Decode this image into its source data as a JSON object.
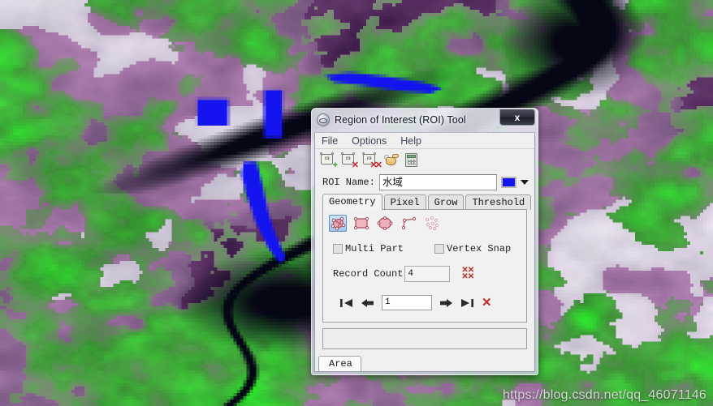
{
  "window": {
    "title": "Region of Interest (ROI) Tool",
    "title_icon": "roi-app-icon",
    "close_label": "x"
  },
  "menubar": {
    "items": [
      {
        "label": "File"
      },
      {
        "label": "Options"
      },
      {
        "label": "Help"
      }
    ]
  },
  "toolbar": {
    "items": [
      {
        "name": "new-roi-icon",
        "badge": "+",
        "glyph": "roi"
      },
      {
        "name": "delete-roi-icon",
        "badge": "x",
        "glyph": "roi"
      },
      {
        "name": "delete-all-roi-icon",
        "badge": "xx",
        "glyph": "roi"
      },
      {
        "name": "hand-pointer-icon"
      },
      {
        "name": "statistics-calculator-icon"
      }
    ]
  },
  "roi_name": {
    "label": "ROI Name:",
    "value": "水域",
    "color": "#1414ec"
  },
  "tabs": [
    {
      "label": "Geometry",
      "active": true
    },
    {
      "label": "Pixel",
      "active": false
    },
    {
      "label": "Grow",
      "active": false
    },
    {
      "label": "Threshold",
      "active": false
    }
  ],
  "geometry": {
    "shapes": [
      {
        "name": "polygon-tool",
        "selected": true
      },
      {
        "name": "rectangle-tool",
        "selected": false
      },
      {
        "name": "ellipse-tool",
        "selected": false
      },
      {
        "name": "polyline-tool",
        "selected": false
      },
      {
        "name": "point-tool",
        "selected": false
      }
    ],
    "checkboxes": [
      {
        "name": "multi-part-checkbox",
        "label": "Multi Part",
        "checked": false
      },
      {
        "name": "vertex-snap-checkbox",
        "label": "Vertex Snap",
        "checked": false
      }
    ],
    "record_count": {
      "label": "Record Count",
      "value": "4",
      "delete_all_glyph": "xx"
    },
    "navigation": {
      "first": "first-record-button",
      "previous": "previous-record-button",
      "value": "1",
      "next": "next-record-button",
      "last": "last-record-button",
      "delete": "delete-record-button",
      "delete_glyph": "✕"
    }
  },
  "bottom_tabs": [
    {
      "label": "Area",
      "active": true
    }
  ],
  "watermark": {
    "text": "https://blog.csdn.net/qq_46071146"
  },
  "image": {
    "description": "false-color satellite scene with blue ROI polygons over dark water",
    "roi_color": "#1414f0",
    "palette": {
      "water": "#050510",
      "vegetation": "#3fbf3f",
      "soil": "#8a4f7d",
      "bright": "#f2eaf4"
    }
  }
}
